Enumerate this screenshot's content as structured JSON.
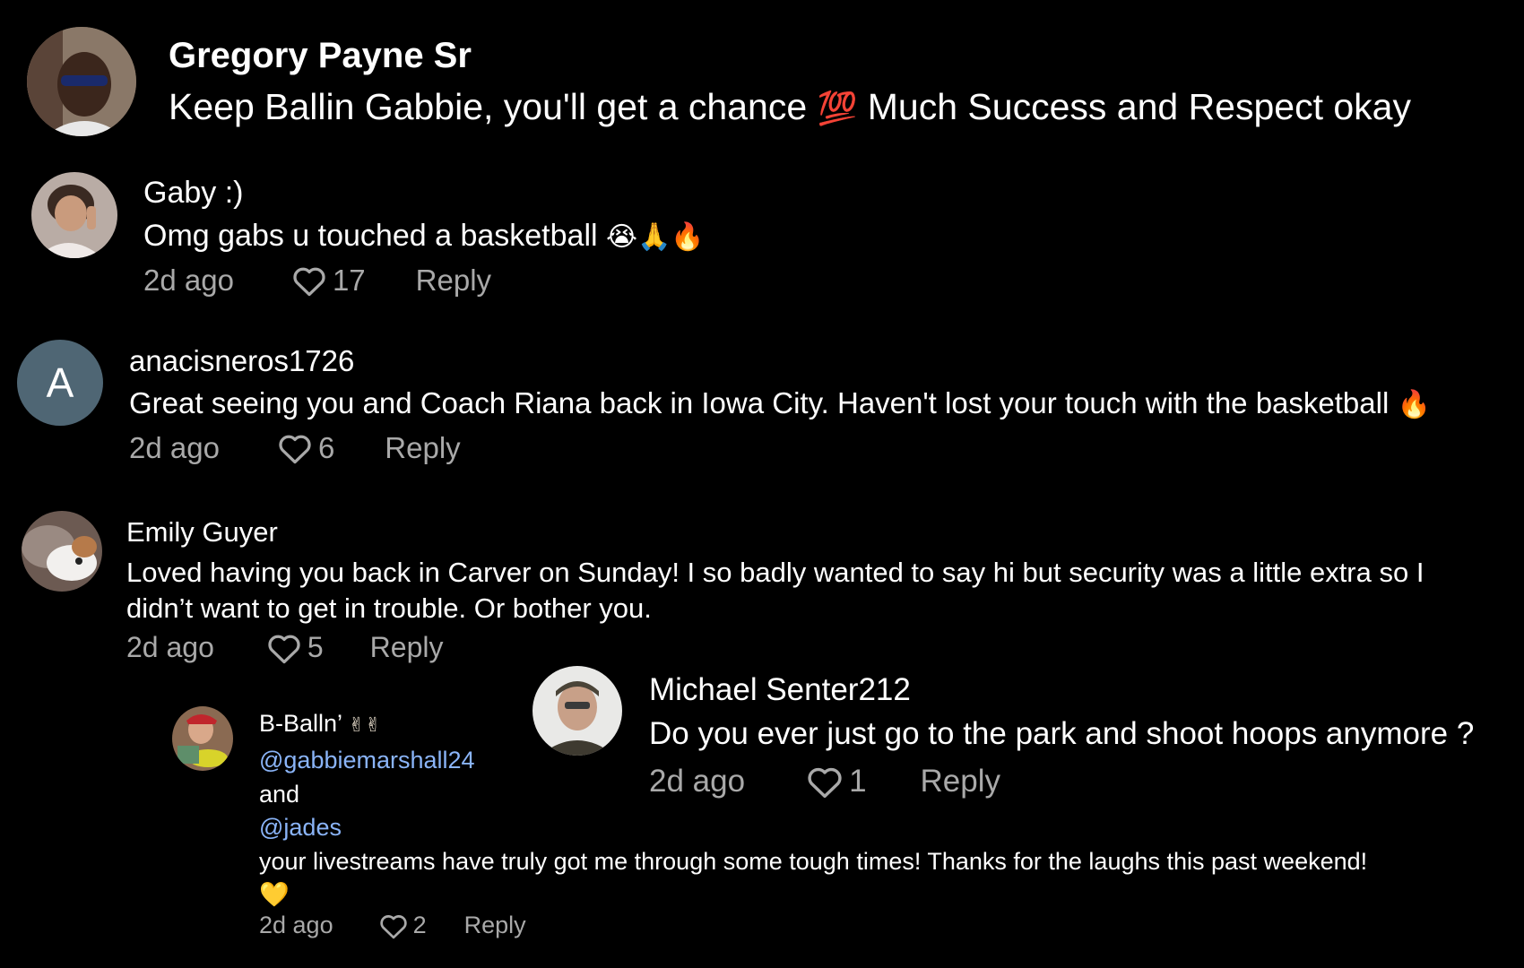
{
  "comments": [
    {
      "username": "Gregory Payne Sr",
      "text_part1": "Keep Ballin Gabbie, you'll get a chance",
      "emoji": "💯",
      "text_part2": "Much Success and Respect okay"
    },
    {
      "username": "Gaby :)",
      "text": "Omg gabs u touched a basketball",
      "emojis": "😭🙏🔥",
      "time": "2d ago",
      "likes": "17",
      "reply": "Reply"
    },
    {
      "username": "anacisneros1726",
      "avatar_letter": "A",
      "text": "Great seeing you and Coach Riana back in Iowa City. Haven't lost your touch with the basketball",
      "emoji": "🔥",
      "time": "2d ago",
      "likes": "6",
      "reply": "Reply"
    },
    {
      "username": "Emily Guyer",
      "text_line1": "Loved having you back in Carver on Sunday! I so badly wanted to say hi but security was a little extra so I",
      "text_line2": "didn’t want to get in trouble. Or bother you.",
      "time": "2d ago",
      "likes": "5",
      "reply": "Reply"
    },
    {
      "username": "Michael Senter212",
      "text": "Do you ever just go to the park and shoot hoops anymore ?",
      "time": "2d ago",
      "likes": "1",
      "reply": "Reply"
    },
    {
      "username": "B-Balln’",
      "username_emojis": "✌✌",
      "mention1": "@gabbiemarshall24",
      "connector": "and",
      "mention2": "@jades",
      "text_line1": "your livestreams have truly got me through some tough times! Thanks for the laughs this past weekend!",
      "text_line2": "💛",
      "time": "2d ago",
      "likes": "2",
      "reply": "Reply"
    }
  ],
  "colors": {
    "background": "#000000",
    "text": "#ffffff",
    "meta": "#a9a9a9",
    "mention": "#8ab4f8",
    "letter_avatar_bg": "#4f6674"
  },
  "icons": [
    "heart-icon",
    "avatar-photo",
    "hundred-points-emoji",
    "crying-face-emoji",
    "folded-hands-emoji",
    "fire-emoji",
    "victory-hand-emoji",
    "yellow-heart-emoji"
  ]
}
